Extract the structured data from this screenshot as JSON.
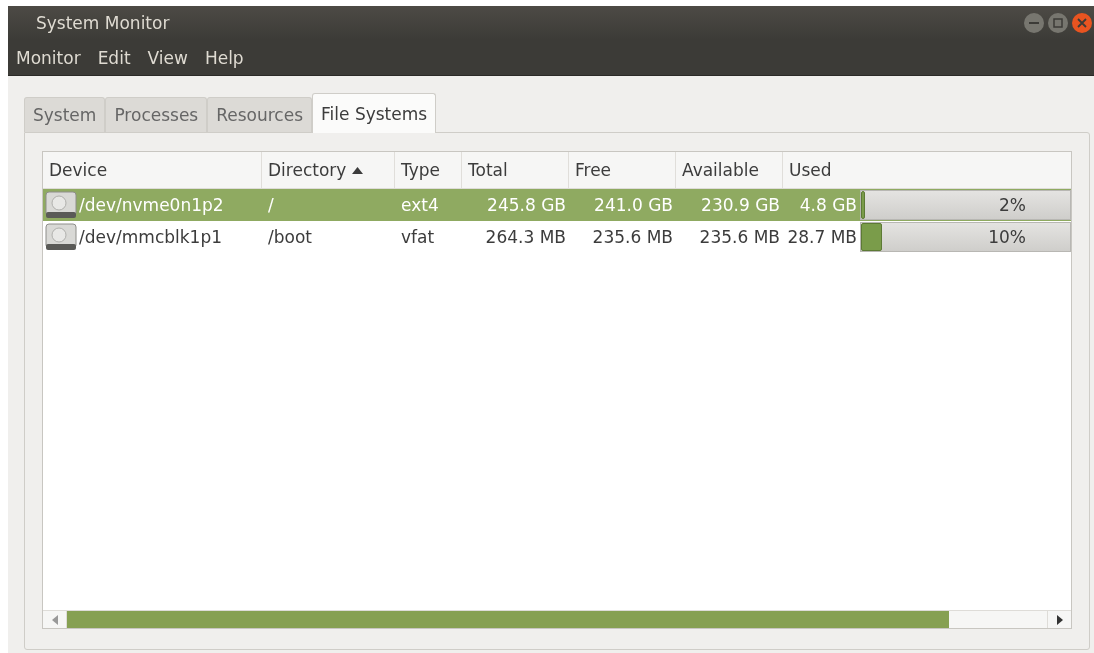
{
  "window": {
    "title": "System Monitor"
  },
  "menu": [
    "Monitor",
    "Edit",
    "View",
    "Help"
  ],
  "tabs": [
    {
      "label": "System",
      "selected": false
    },
    {
      "label": "Processes",
      "selected": false
    },
    {
      "label": "Resources",
      "selected": false
    },
    {
      "label": "File Systems",
      "selected": true
    }
  ],
  "table": {
    "columns": [
      {
        "label": "Device",
        "sorted": false
      },
      {
        "label": "Directory",
        "sorted": true
      },
      {
        "label": "Type",
        "sorted": false
      },
      {
        "label": "Total",
        "sorted": false
      },
      {
        "label": "Free",
        "sorted": false
      },
      {
        "label": "Available",
        "sorted": false
      },
      {
        "label": "Used",
        "sorted": false
      }
    ],
    "rows": [
      {
        "device": "/dev/nvme0n1p2",
        "directory": "/",
        "type": "ext4",
        "total": "245.8 GB",
        "free": "241.0 GB",
        "available": "230.9 GB",
        "used": "4.8 GB",
        "level": 0.02,
        "percent": "2%",
        "selected": true
      },
      {
        "device": "/dev/mmcblk1p1",
        "directory": "/boot",
        "type": "vfat",
        "total": "264.3 MB",
        "free": "235.6 MB",
        "available": "235.6 MB",
        "used": "28.7 MB",
        "level": 0.1,
        "percent": "10%",
        "selected": false
      }
    ]
  }
}
